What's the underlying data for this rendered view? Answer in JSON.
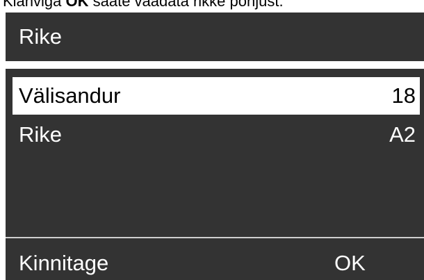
{
  "instruction": {
    "prefix": "Klahviga ",
    "key": "OK",
    "suffix": " saate vaadata rikke põhjust."
  },
  "screen": {
    "title": "Rike",
    "rows": [
      {
        "label": "Välisandur",
        "value": "18",
        "selected": true
      },
      {
        "label": "Rike",
        "value": "A2",
        "selected": false
      }
    ],
    "footer": {
      "left_label": "Kinnitage",
      "right_label": "OK"
    }
  },
  "colors": {
    "screen_background": "#333333",
    "text": "#ffffff",
    "selection_background": "#ffffff",
    "selection_text": "#000000"
  }
}
